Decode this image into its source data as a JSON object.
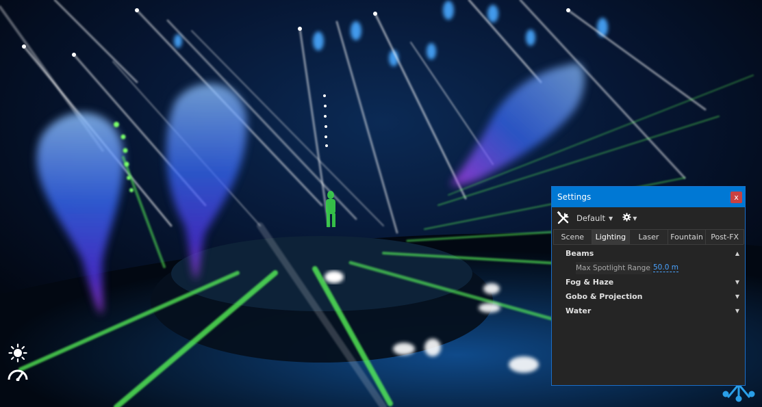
{
  "settings": {
    "title": "Settings",
    "close_label": "x",
    "preset_label": "Default",
    "tabs": [
      {
        "label": "Scene",
        "active": false
      },
      {
        "label": "Lighting",
        "active": true
      },
      {
        "label": "Laser",
        "active": false
      },
      {
        "label": "Fountain",
        "active": false
      },
      {
        "label": "Post-FX",
        "active": false
      }
    ],
    "sections": {
      "beams": {
        "label": "Beams",
        "expanded": true,
        "max_spotlight_range": {
          "label": "Max Spotlight Range",
          "value": "50.0 m"
        }
      },
      "fog": {
        "label": "Fog & Haze",
        "expanded": false
      },
      "gobo": {
        "label": "Gobo & Projection",
        "expanded": false
      },
      "water": {
        "label": "Water",
        "expanded": false
      }
    }
  },
  "hud": {
    "icons": [
      "sun-icon",
      "gauge-icon",
      "network-logo-icon"
    ]
  },
  "colors": {
    "accent": "#0078d4",
    "close": "#c94141",
    "value_link": "#4aa3ff",
    "beam_green": "#5dff5a",
    "fog_blue": "#3a6cff",
    "fog_purple": "#b03cff"
  }
}
